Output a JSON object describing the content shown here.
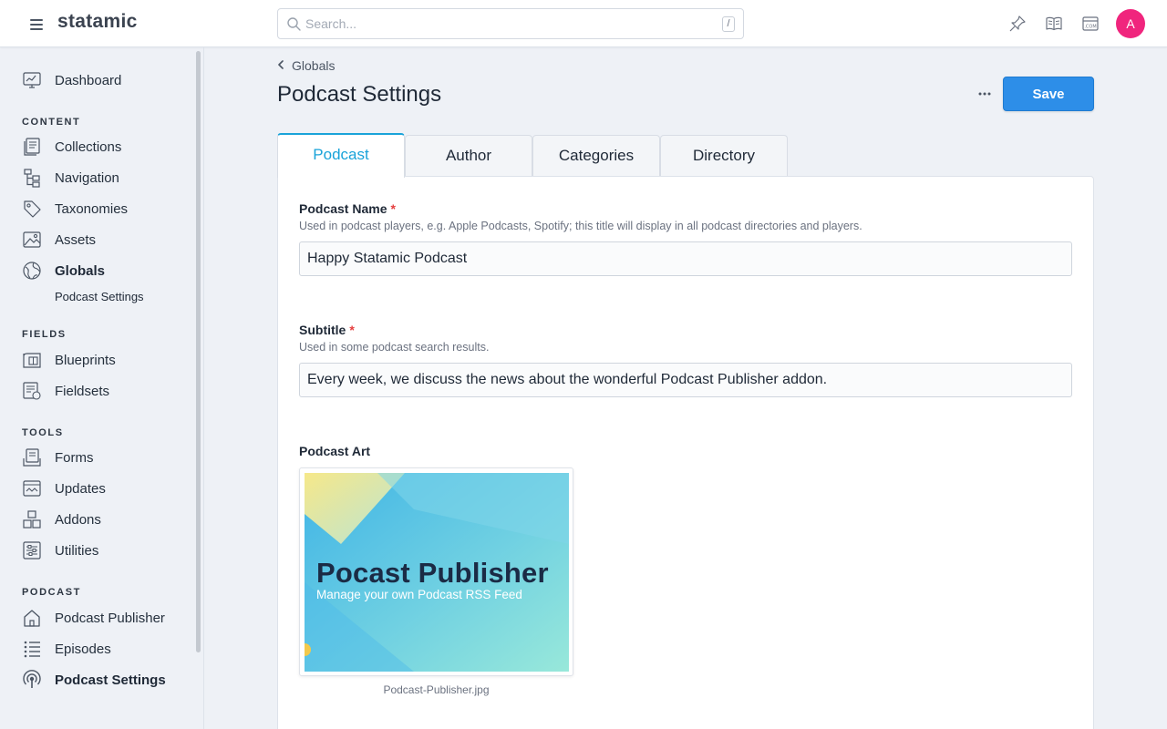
{
  "app": {
    "brand": "statamic"
  },
  "search": {
    "placeholder": "Search...",
    "shortcut": "/"
  },
  "user": {
    "avatar_initial": "A",
    "avatar_color": "#f0257d"
  },
  "sidebar": {
    "top": [
      {
        "label": "Dashboard",
        "icon": "dashboard-icon"
      }
    ],
    "sections": {
      "content": {
        "title": "CONTENT",
        "items": [
          {
            "label": "Collections",
            "icon": "collections-icon"
          },
          {
            "label": "Navigation",
            "icon": "navigation-icon"
          },
          {
            "label": "Taxonomies",
            "icon": "tag-icon"
          },
          {
            "label": "Assets",
            "icon": "assets-icon"
          },
          {
            "label": "Globals",
            "icon": "globe-icon",
            "active": true
          }
        ],
        "subitems": [
          {
            "label": "Podcast Settings"
          }
        ]
      },
      "fields": {
        "title": "FIELDS",
        "items": [
          {
            "label": "Blueprints",
            "icon": "blueprint-icon"
          },
          {
            "label": "Fieldsets",
            "icon": "fieldset-icon"
          }
        ]
      },
      "tools": {
        "title": "TOOLS",
        "items": [
          {
            "label": "Forms",
            "icon": "forms-icon"
          },
          {
            "label": "Updates",
            "icon": "updates-icon"
          },
          {
            "label": "Addons",
            "icon": "addons-icon"
          },
          {
            "label": "Utilities",
            "icon": "utilities-icon"
          }
        ]
      },
      "podcast": {
        "title": "PODCAST",
        "items": [
          {
            "label": "Podcast Publisher",
            "icon": "home-icon"
          },
          {
            "label": "Episodes",
            "icon": "list-icon"
          },
          {
            "label": "Podcast Settings",
            "icon": "podcast-icon",
            "active": true
          }
        ]
      }
    }
  },
  "breadcrumb": {
    "label": "Globals"
  },
  "page": {
    "title": "Podcast Settings",
    "save_label": "Save"
  },
  "tabs": [
    {
      "label": "Podcast",
      "active": true
    },
    {
      "label": "Author"
    },
    {
      "label": "Categories"
    },
    {
      "label": "Directory"
    }
  ],
  "fields": {
    "podcast_name": {
      "label": "Podcast Name",
      "required_mark": "*",
      "instructions": "Used in podcast players, e.g. Apple Podcasts, Spotify; this title will display in all podcast directories and players.",
      "value": "Happy Statamic Podcast"
    },
    "subtitle": {
      "label": "Subtitle",
      "required_mark": "*",
      "instructions": "Used in some podcast search results.",
      "value": "Every week, we discuss the news about the wonderful Podcast Publisher addon."
    },
    "podcast_art": {
      "label": "Podcast Art",
      "image_title": "Pocast Publisher",
      "image_subtitle": "Manage your own Podcast RSS Feed",
      "filename": "Podcast-Publisher.jpg"
    }
  },
  "colors": {
    "accent": "#19a3d9",
    "button": "#2d8ee8",
    "required": "#e53e3e"
  }
}
